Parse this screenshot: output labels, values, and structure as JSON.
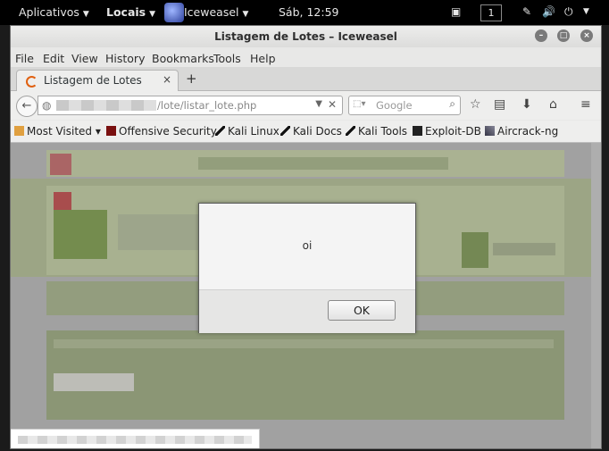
{
  "topbar": {
    "applications": "Aplicativos",
    "places": "Locais",
    "active_app": "Iceweasel",
    "clock": "Sáb, 12:59",
    "workspace": "1"
  },
  "window": {
    "title": "Listagem de Lotes – Iceweasel"
  },
  "menubar": [
    "File",
    "Edit",
    "View",
    "History",
    "Bookmarks",
    "Tools",
    "Help"
  ],
  "tab": {
    "title": "Listagem de Lotes",
    "close": "×",
    "new_tab": "+"
  },
  "navbar": {
    "url_visible": "/lote/listar_lote.php",
    "search_placeholder": "Google"
  },
  "bookmarks": [
    {
      "label": "Most Visited ▾",
      "icon": "folder-icon"
    },
    {
      "label": "Offensive Security",
      "icon": "offsec-icon"
    },
    {
      "label": "Kali Linux",
      "icon": "kali-dragon-icon"
    },
    {
      "label": "Kali Docs",
      "icon": "kali-dragon-icon"
    },
    {
      "label": "Kali Tools",
      "icon": "kali-dragon-icon"
    },
    {
      "label": "Exploit-DB",
      "icon": "exploit-db-icon"
    },
    {
      "label": "Aircrack-ng",
      "icon": "aircrack-icon"
    }
  ],
  "dialog": {
    "message": "oi",
    "ok_label": "OK"
  },
  "colors": {
    "topbar_bg": "#000000",
    "page_green": "#8fa86a",
    "accent_red": "#c83c3c"
  }
}
